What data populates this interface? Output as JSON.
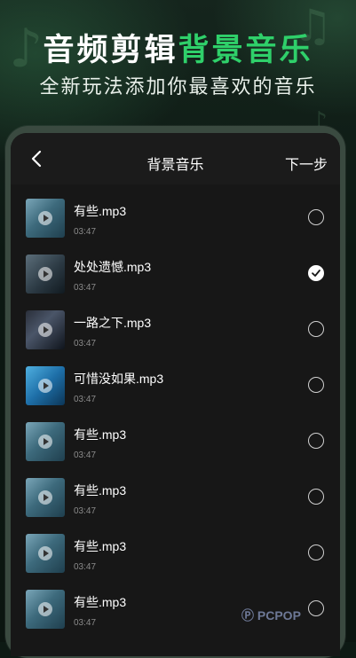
{
  "promo": {
    "headline_white": "音频剪辑",
    "headline_green": "背景音乐",
    "subtitle": "全新玩法添加你最喜欢的音乐"
  },
  "nav": {
    "title": "背景音乐",
    "next_label": "下一步"
  },
  "songs": [
    {
      "name": "有些.mp3",
      "duration": "03:47",
      "selected": false,
      "thumb": "blue-green"
    },
    {
      "name": "处处遗憾.mp3",
      "duration": "03:47",
      "selected": true,
      "thumb": "dark-portrait"
    },
    {
      "name": "一路之下.mp3",
      "duration": "03:47",
      "selected": false,
      "thumb": "singer"
    },
    {
      "name": "可惜没如果.mp3",
      "duration": "03:47",
      "selected": false,
      "thumb": "blue"
    },
    {
      "name": "有些.mp3",
      "duration": "03:47",
      "selected": false,
      "thumb": "blue-green"
    },
    {
      "name": "有些.mp3",
      "duration": "03:47",
      "selected": false,
      "thumb": "blue-green"
    },
    {
      "name": "有些.mp3",
      "duration": "03:47",
      "selected": false,
      "thumb": "blue-green"
    },
    {
      "name": "有些.mp3",
      "duration": "03:47",
      "selected": false,
      "thumb": "blue-green"
    }
  ],
  "colors": {
    "accent": "#2fd06a",
    "background": "#0d1a14",
    "panel": "#171717"
  },
  "watermark": "PCPOP"
}
